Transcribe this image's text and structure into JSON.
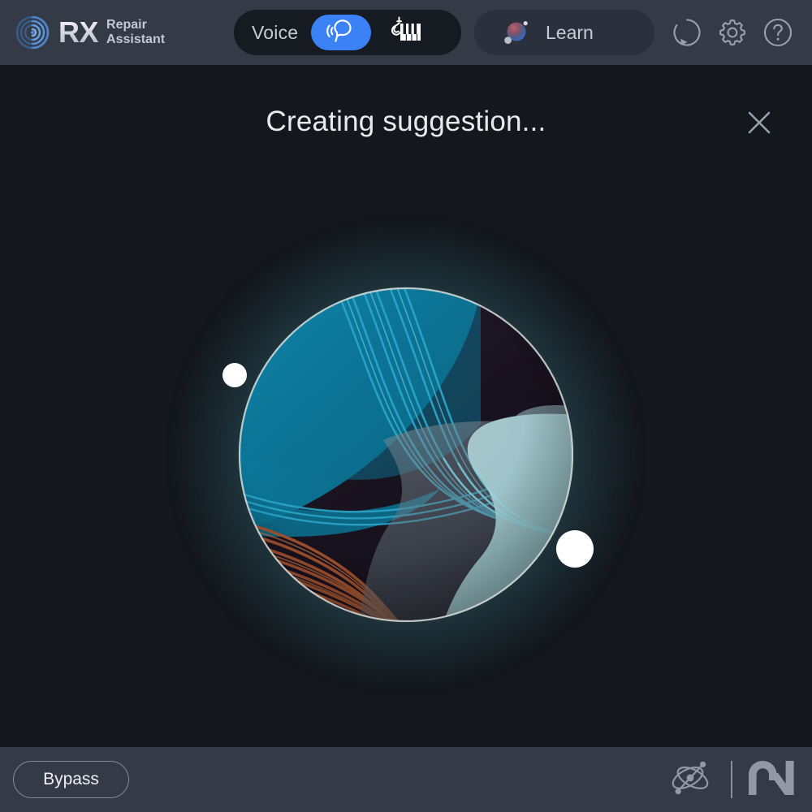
{
  "app": {
    "title_main": "RX",
    "title_line1": "Repair",
    "title_line2": "Assistant",
    "logo_icon": "rx-concentric-waves-icon"
  },
  "topbar": {
    "background": "#343b47",
    "mode_toggle": {
      "label": "Voice",
      "active_option": "voice",
      "options": [
        {
          "id": "voice",
          "icon": "speaking-head-icon",
          "active": true,
          "accent": "#3b82f6"
        },
        {
          "id": "music",
          "icon": "guitar-piano-icon",
          "active": false
        }
      ]
    },
    "learn_button": {
      "label": "Learn",
      "icon": "learn-orb-icon",
      "background": "#2b313c"
    },
    "icons": [
      {
        "name": "process-circle-arrow-icon",
        "title": "Process"
      },
      {
        "name": "gear-icon",
        "title": "Settings"
      },
      {
        "name": "help-question-icon",
        "title": "Help"
      }
    ]
  },
  "main": {
    "status_title": "Creating suggestion...",
    "close_icon": "close-icon",
    "background": "#14171c",
    "visualizer": {
      "name": "suggestion-orb",
      "glow_color": "#8fd9e3",
      "rim_color": "#cfd4d2",
      "regions": {
        "teal_fill": "#0c7496",
        "dark_fill": "#1b1420",
        "light_blob": "#9dc4ca",
        "cyan_lines": "#2aa5c8",
        "orange_lines": "#a85530"
      },
      "satellites": [
        {
          "name": "orb-dot-left",
          "color": "#ffffff",
          "size": 30
        },
        {
          "name": "orb-dot-right",
          "color": "#ffffff",
          "size": 46
        }
      ]
    }
  },
  "bottombar": {
    "background": "#343b47",
    "bypass_label": "Bypass",
    "logos": [
      {
        "name": "izotope-logo",
        "title": "iZotope"
      },
      {
        "name": "native-instruments-logo",
        "title": "Native Instruments"
      }
    ]
  }
}
